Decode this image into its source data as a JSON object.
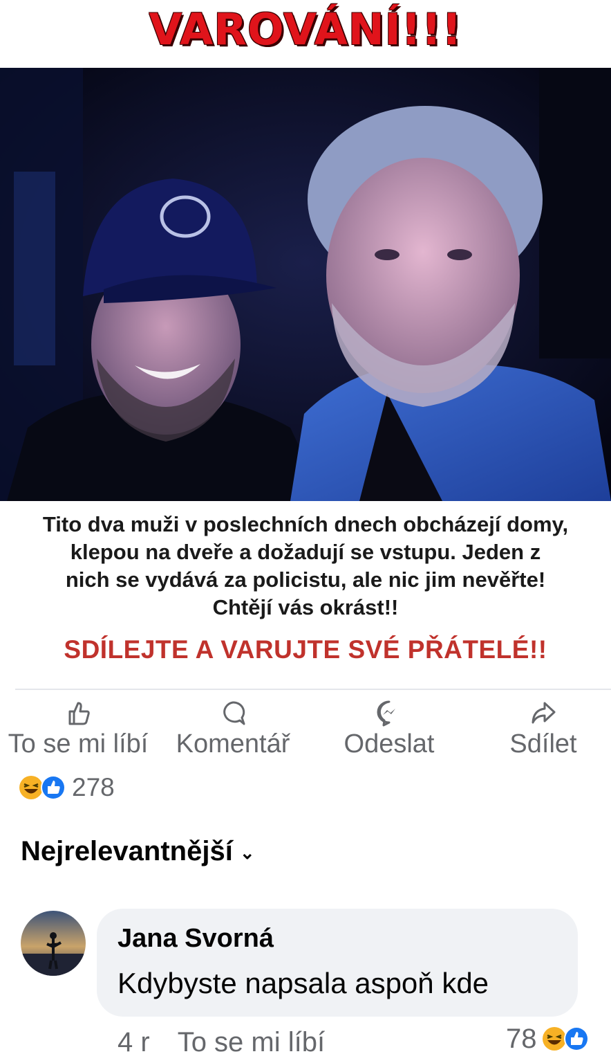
{
  "banner": {
    "title": "VAROVÁNÍ!!!"
  },
  "post": {
    "caption_lines": [
      "Tito dva muži v poslechních dnech obcházejí domy,",
      "klepou na dveře a dožadují se vstupu. Jeden z",
      "nich se vydává za policistu, ale nic jim nevěřte!",
      "Chtějí vás okrást!!"
    ],
    "call_to_action": "SDÍLEJTE A VARUJTE SVÉ PŘÁTELÉ!!"
  },
  "actions": {
    "like": {
      "label": "To se mi líbí",
      "icon": "thumbs-up-icon"
    },
    "comment": {
      "label": "Komentář",
      "icon": "comment-icon"
    },
    "send": {
      "label": "Odeslat",
      "icon": "messenger-icon"
    },
    "share": {
      "label": "Sdílet",
      "icon": "share-arrow-icon"
    }
  },
  "reactions": {
    "count": "278",
    "types": [
      "haha",
      "like"
    ]
  },
  "comments_sort": {
    "label": "Nejrelevantnější",
    "icon": "chevron-down-icon"
  },
  "comment": {
    "author": "Jana Svorná",
    "text": "Kdybyste napsala aspoň kde",
    "age": "4 r",
    "like_label": "To se mi líbí",
    "reaction_count": "78",
    "reaction_types": [
      "haha",
      "like"
    ]
  },
  "colors": {
    "warning_red": "#e0141b",
    "cta_red": "#c0322c",
    "meta_gray": "#65676b",
    "like_blue": "#1877f2",
    "haha_yellow": "#f7b125",
    "bubble_bg": "#f0f2f5"
  }
}
